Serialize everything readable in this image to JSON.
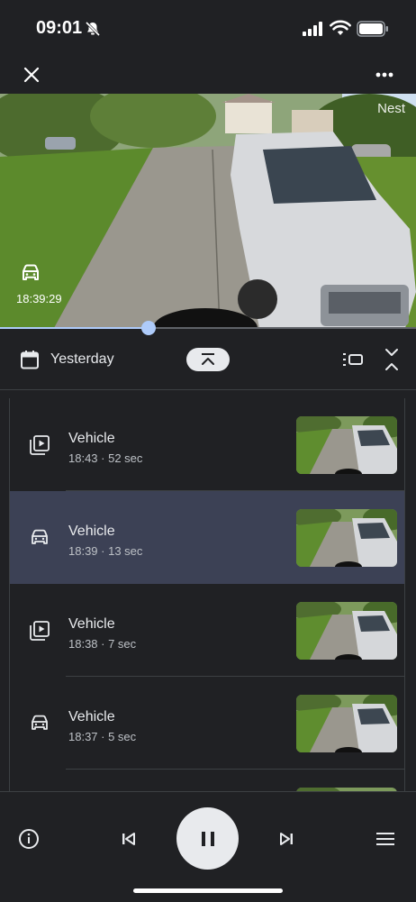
{
  "status_bar": {
    "time": "09:01",
    "icons": [
      "bell-off-icon",
      "signal-icon",
      "wifi-icon",
      "battery-icon"
    ]
  },
  "top_bar": {
    "close_icon": "close-icon",
    "more_icon": "more-horizontal-icon"
  },
  "video": {
    "brand_watermark": "Nest",
    "timestamp": "18:39:29",
    "event_icon": "car-icon",
    "playback_progress": 0.357
  },
  "timeline_header": {
    "date_label": "Yesterday",
    "calendar_icon": "calendar-icon",
    "collapse_icon": "collapse-up-icon",
    "list_view_icon": "list-view-icon",
    "compress_icon": "compress-icon"
  },
  "events": [
    {
      "title": "Vehicle",
      "subtitle": "18:43 · 52 sec",
      "icon": "video-library-icon",
      "selected": false
    },
    {
      "title": "Vehicle",
      "subtitle": "18:39 · 13 sec",
      "icon": "car-icon",
      "selected": true
    },
    {
      "title": "Vehicle",
      "subtitle": "18:38 · 7 sec",
      "icon": "video-library-icon",
      "selected": false
    },
    {
      "title": "Vehicle",
      "subtitle": "18:37 · 5 sec",
      "icon": "car-icon",
      "selected": false
    }
  ],
  "controls": {
    "info_icon": "info-icon",
    "previous_icon": "skip-previous-icon",
    "pause_icon": "pause-icon",
    "next_icon": "skip-next-icon",
    "menu_icon": "menu-icon"
  },
  "colors": {
    "background": "#202124",
    "selected_row": "#3c4155",
    "accent": "#aecbfa"
  }
}
